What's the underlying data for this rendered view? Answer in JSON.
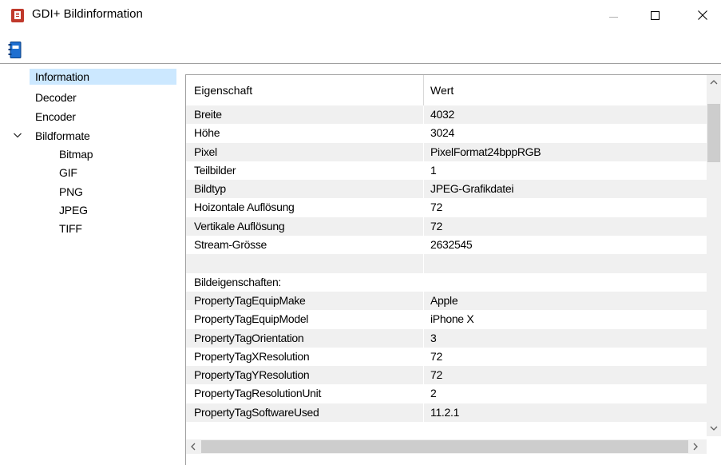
{
  "window": {
    "title": "GDI+ Bildinformation"
  },
  "tree": [
    {
      "label": "Information",
      "level": 0,
      "selected": true
    },
    {
      "label": "Decoder",
      "level": 0
    },
    {
      "label": "Encoder",
      "level": 0
    },
    {
      "label": "Bildformate",
      "level": 0,
      "expanded": true
    },
    {
      "label": "Bitmap",
      "level": 1
    },
    {
      "label": "GIF",
      "level": 1
    },
    {
      "label": "PNG",
      "level": 1
    },
    {
      "label": "JPEG",
      "level": 1
    },
    {
      "label": "TIFF",
      "level": 1
    }
  ],
  "grid": {
    "headers": {
      "property": "Eigenschaft",
      "value": "Wert"
    },
    "rows": [
      {
        "property": "Breite",
        "value": "4032"
      },
      {
        "property": "Höhe",
        "value": "3024"
      },
      {
        "property": "Pixel",
        "value": "PixelFormat24bppRGB"
      },
      {
        "property": "Teilbilder",
        "value": "1"
      },
      {
        "property": "Bildtyp",
        "value": "JPEG-Grafikdatei"
      },
      {
        "property": "Hoizontale Auflösung",
        "value": "72"
      },
      {
        "property": "Vertikale Auflösung",
        "value": "72"
      },
      {
        "property": "Stream-Grösse",
        "value": "2632545"
      },
      {
        "property": "",
        "value": ""
      },
      {
        "property": "Bildeigenschaften:",
        "value": ""
      },
      {
        "property": "PropertyTagEquipMake",
        "value": "Apple"
      },
      {
        "property": "PropertyTagEquipModel",
        "value": "iPhone X"
      },
      {
        "property": "PropertyTagOrientation",
        "value": "3"
      },
      {
        "property": "PropertyTagXResolution",
        "value": "72"
      },
      {
        "property": "PropertyTagYResolution",
        "value": "72"
      },
      {
        "property": "PropertyTagResolutionUnit",
        "value": "2"
      },
      {
        "property": "PropertyTagSoftwareUsed",
        "value": "11.2.1"
      }
    ]
  },
  "icons": {
    "app": "app-document-icon",
    "toolbar": "book-icon",
    "minimize": "minimize-icon",
    "maximize": "maximize-icon",
    "close": "close-icon"
  },
  "colors": {
    "selection": "#cce8ff",
    "alt_row": "#f0f0f0",
    "book_blue": "#1f6fd0"
  }
}
